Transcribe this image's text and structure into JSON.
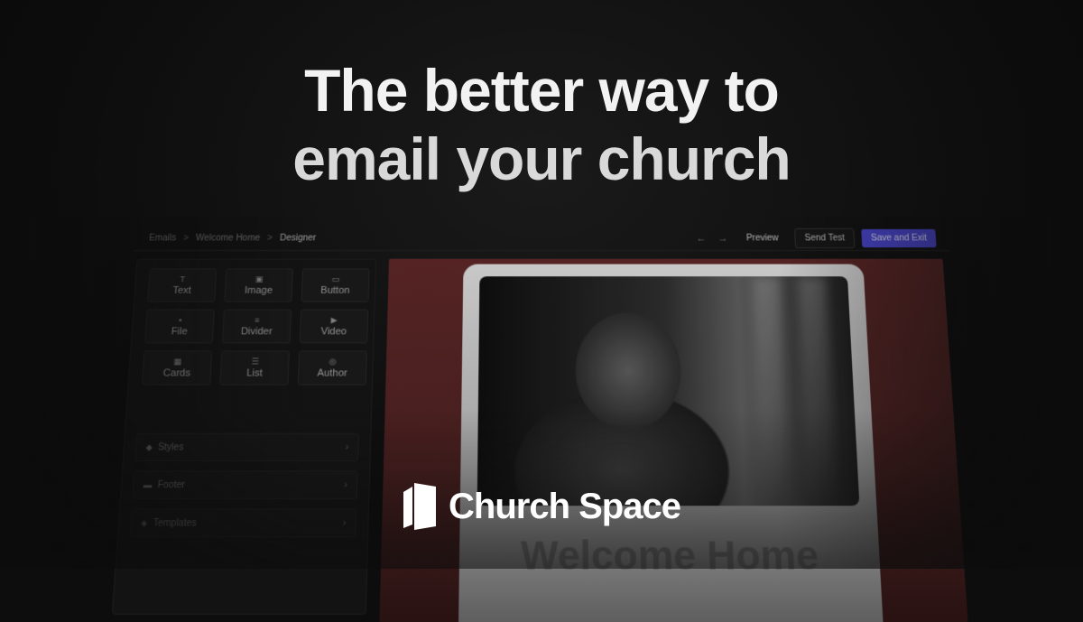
{
  "headline": {
    "line1": "The better way to",
    "line2": "email your church"
  },
  "breadcrumb": {
    "items": [
      "Emails",
      "Welcome Home",
      "Designer"
    ],
    "separator": ">"
  },
  "toolbar": {
    "undo_icon": "←",
    "redo_icon": "→",
    "preview_label": "Preview",
    "send_test_label": "Send Test",
    "save_exit_label": "Save and Exit"
  },
  "blocks": [
    {
      "label": "Text",
      "icon": "T",
      "icon_name": "text-icon"
    },
    {
      "label": "Image",
      "icon": "▣",
      "icon_name": "image-icon"
    },
    {
      "label": "Button",
      "icon": "▭",
      "icon_name": "button-icon"
    },
    {
      "label": "File",
      "icon": "▪",
      "icon_name": "file-icon"
    },
    {
      "label": "Divider",
      "icon": "≡",
      "icon_name": "divider-icon"
    },
    {
      "label": "Video",
      "icon": "▶",
      "icon_name": "video-icon"
    },
    {
      "label": "Cards",
      "icon": "▦",
      "icon_name": "cards-icon"
    },
    {
      "label": "List",
      "icon": "☰",
      "icon_name": "list-icon"
    },
    {
      "label": "Author",
      "icon": "◎",
      "icon_name": "author-icon"
    }
  ],
  "panels": [
    {
      "label": "Styles",
      "icon": "◆"
    },
    {
      "label": "Footer",
      "icon": "▬"
    },
    {
      "label": "Templates",
      "icon": "◈"
    }
  ],
  "email_preview": {
    "heading": "Welcome Home"
  },
  "brand": {
    "name": "Church Space"
  },
  "colors": {
    "background": "#0d0d0d",
    "accent": "#4a46d6",
    "canvas": "#5a2424"
  }
}
